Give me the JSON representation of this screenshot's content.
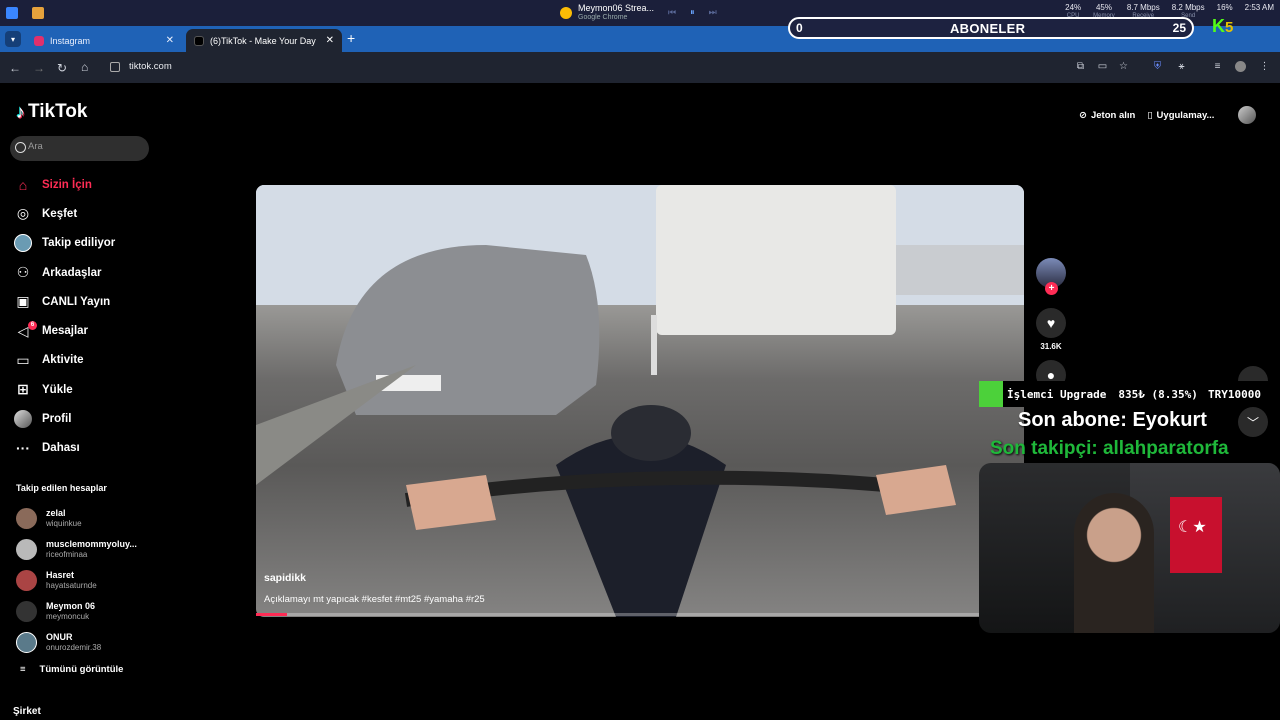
{
  "taskbar": {
    "media_title": "Meymon06 Strea...",
    "media_app": "Google Chrome",
    "stats": [
      {
        "value": "24%",
        "label": "CPU"
      },
      {
        "value": "45%",
        "label": "Memory"
      },
      {
        "value": "8.7 Mbps",
        "label": "Receive"
      },
      {
        "value": "8.2 Mbps",
        "label": "Send"
      },
      {
        "value": "16%",
        "label": ""
      }
    ],
    "time": "2:53 AM"
  },
  "browser": {
    "tabs": [
      {
        "label": "Instagram",
        "active": false,
        "fav_color": "#e1306c"
      },
      {
        "label": "(6)TikTok - Make Your Day",
        "active": true,
        "fav_color": "#000000"
      }
    ],
    "url": "tiktok.com"
  },
  "tiktok": {
    "logo": "TikTok",
    "search_placeholder": "Ara",
    "menu": [
      {
        "label": "Sizin İçin",
        "icon": "home-icon",
        "glyph": "⌂",
        "active": true
      },
      {
        "label": "Keşfet",
        "icon": "compass-icon",
        "glyph": "◎",
        "active": false
      },
      {
        "label": "Takip ediliyor",
        "icon": "following-avatar-icon",
        "glyph": "●",
        "active": false
      },
      {
        "label": "Arkadaşlar",
        "icon": "friends-icon",
        "glyph": "⚇",
        "active": false
      },
      {
        "label": "CANLI Yayın",
        "icon": "live-icon",
        "glyph": "▣",
        "active": false
      },
      {
        "label": "Mesajlar",
        "icon": "messages-icon",
        "glyph": "◁",
        "active": false,
        "badge": "6"
      },
      {
        "label": "Aktivite",
        "icon": "activity-icon",
        "glyph": "▭",
        "active": false
      },
      {
        "label": "Yükle",
        "icon": "upload-icon",
        "glyph": "⊞",
        "active": false
      },
      {
        "label": "Profil",
        "icon": "profile-avatar-icon",
        "glyph": "●",
        "active": false
      },
      {
        "label": "Dahası",
        "icon": "more-icon",
        "glyph": "···",
        "active": false
      }
    ],
    "following_title": "Takip edilen hesaplar",
    "following": [
      {
        "name": "zelal",
        "handle": "wiquinkue"
      },
      {
        "name": "musclemommyoluy...",
        "handle": "riceofminaa"
      },
      {
        "name": "Hasret",
        "handle": "hayatsaturnde"
      },
      {
        "name": "Meymon 06",
        "handle": "meymoncuk"
      },
      {
        "name": "ONUR",
        "handle": "onurozdemir.38"
      }
    ],
    "see_all": "Tümünü görüntüle",
    "company": "Şirket",
    "get_coins": "Jeton alın",
    "get_app": "Uygulamay...",
    "video": {
      "author": "sapidikk",
      "description": "Açıklamayı mt yapıcak #kesfet #mt25 #yamaha #r25",
      "likes": "31.6K",
      "progress": 0.04
    }
  },
  "overlay": {
    "subs_title": "ABONELER",
    "subs_current": "0",
    "subs_goal": "25",
    "ticker_label": "İşlemci Upgrade",
    "ticker_price": "835₺ (8.35%)",
    "ticker_symbol": "TRY10000",
    "last_sub": "Son abone: Eyokurt",
    "last_follower": "Son takipçi: allahparatorfa"
  }
}
